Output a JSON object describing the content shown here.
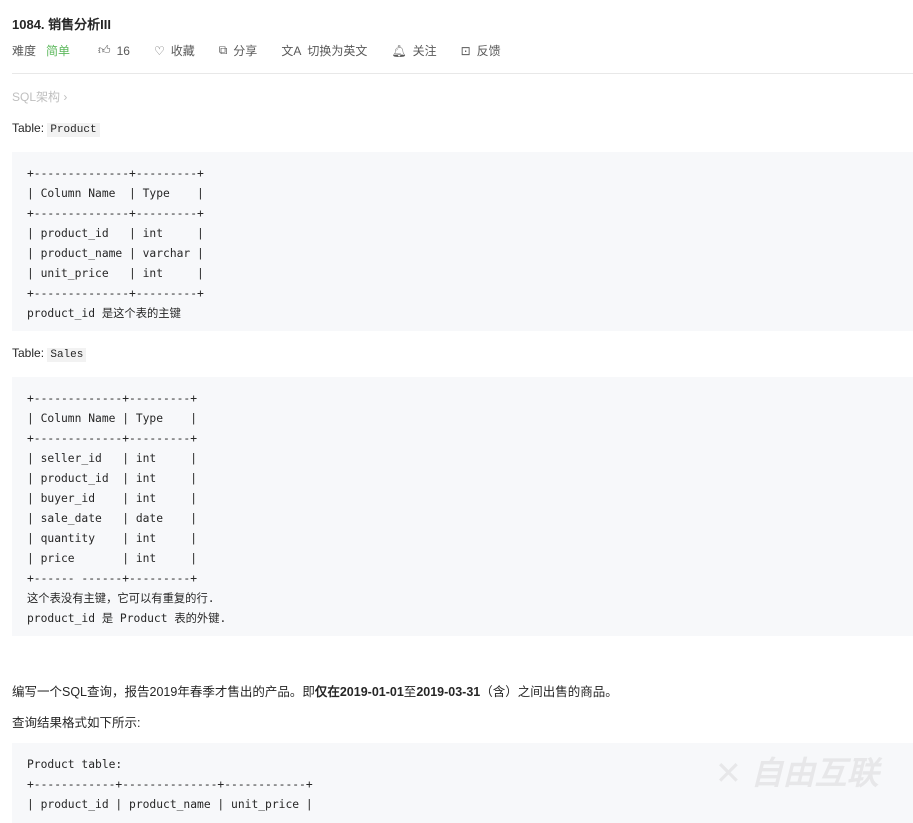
{
  "header": {
    "title": "1084. 销售分析III",
    "difficulty_label": "难度",
    "difficulty": "简单",
    "likes": "16",
    "favorite": "收藏",
    "share": "分享",
    "switch_lang": "切换为英文",
    "follow": "关注",
    "feedback": "反馈"
  },
  "breadcrumb": "SQL架构 ›",
  "product_table": {
    "label": "Table: ",
    "name": "Product",
    "code": "+--------------+---------+\n| Column Name  | Type    |\n+--------------+---------+\n| product_id   | int     |\n| product_name | varchar |\n| unit_price   | int     |\n+--------------+---------+\nproduct_id 是这个表的主键"
  },
  "sales_table": {
    "label": "Table: ",
    "name": "Sales",
    "code": "+-------------+---------+\n| Column Name | Type    |\n+-------------+---------+\n| seller_id   | int     |\n| product_id  | int     |\n| buyer_id    | int     |\n| sale_date   | date    |\n| quantity    | int     |\n| price       | int     |\n+------ ------+---------+\n这个表没有主键，它可以有重复的行.\nproduct_id 是 Product 表的外键."
  },
  "description": {
    "p1_a": "编写一个SQL查询，报告2019年春季才售出的产品。即",
    "p1_b": "仅在",
    "p1_c": "2019-01-01",
    "p1_d": "至",
    "p1_e": "2019-03-31",
    "p1_f": "（含）之间出售的商品。",
    "p2": "查询结果格式如下所示:"
  },
  "example": {
    "code": "Product table:\n+------------+--------------+------------+\n| product_id | product_name | unit_price |"
  },
  "watermark": "自由互联",
  "colors": {
    "easy": "#5cb85c",
    "code_bg": "#f7f8fa"
  }
}
